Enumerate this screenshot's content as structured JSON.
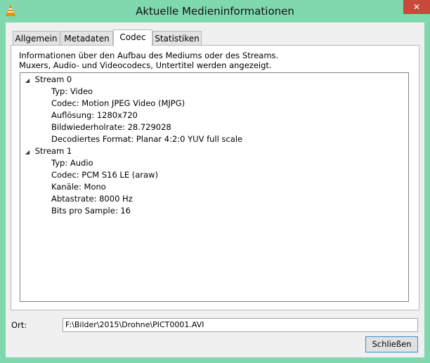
{
  "window": {
    "title": "Aktuelle Medieninformationen",
    "close_glyph": "✕"
  },
  "tabs": [
    {
      "label": "Allgemein"
    },
    {
      "label": "Metadaten"
    },
    {
      "label": "Codec",
      "active": true
    },
    {
      "label": "Statistiken"
    }
  ],
  "codec": {
    "description_line1": "Informationen über den Aufbau des Mediums oder des Streams.",
    "description_line2": "Muxers, Audio- und Videocodecs, Untertitel werden angezeigt.",
    "streams": [
      {
        "label": "Stream 0",
        "items": [
          "Typ: Video",
          "Codec: Motion JPEG Video (MJPG)",
          "Auflösung: 1280x720",
          "Bildwiederholrate: 28.729028",
          "Decodiertes Format: Planar 4:2:0 YUV full scale"
        ]
      },
      {
        "label": "Stream 1",
        "items": [
          "Typ: Audio",
          "Codec: PCM S16 LE (araw)",
          "Kanäle: Mono",
          "Abtastrate: 8000 Hz",
          "Bits pro Sample: 16"
        ]
      }
    ]
  },
  "location": {
    "label": "Ort:",
    "value": "F:\\Bilder\\2015\\Drohne\\PICT0001.AVI"
  },
  "buttons": {
    "close": "Schließen"
  },
  "icons": {
    "app": "vlc-cone-icon",
    "expand": "expanded-triangle-icon"
  },
  "colors": {
    "frame": "#7fd8ae",
    "close_button": "#c7493a",
    "focus_border": "#3a8bd6"
  }
}
